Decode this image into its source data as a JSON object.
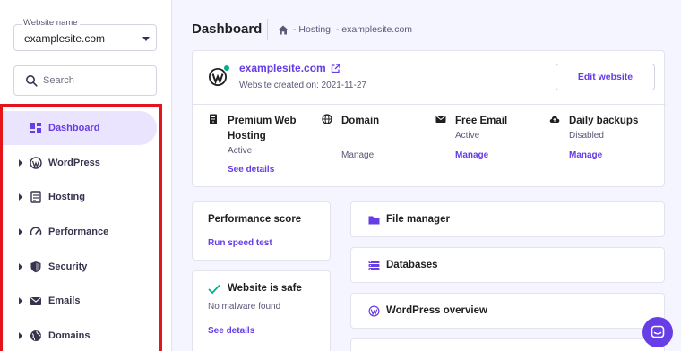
{
  "sidebar": {
    "website_select": {
      "label": "Website name",
      "value": "examplesite.com"
    },
    "search": {
      "placeholder": "Search"
    },
    "items": [
      {
        "label": "Dashboard",
        "icon": "dashboard-icon",
        "active": true
      },
      {
        "label": "WordPress",
        "icon": "wordpress-icon",
        "active": false
      },
      {
        "label": "Hosting",
        "icon": "server-icon",
        "active": false
      },
      {
        "label": "Performance",
        "icon": "speedometer-icon",
        "active": false
      },
      {
        "label": "Security",
        "icon": "shield-icon",
        "active": false
      },
      {
        "label": "Emails",
        "icon": "envelope-icon",
        "active": false
      },
      {
        "label": "Domains",
        "icon": "globe-icon",
        "active": false
      }
    ]
  },
  "header": {
    "title": "Dashboard",
    "breadcrumb": "- Hosting  - examplesite.com"
  },
  "site_card": {
    "name": "examplesite.com",
    "created": "Website created on: 2021-11-27",
    "edit_label": "Edit website",
    "services": [
      {
        "title_line1": "Premium Web",
        "title_line2": "Hosting",
        "status": "Active",
        "link": "See details",
        "icon": "server-icon"
      },
      {
        "title_line1": "Domain",
        "status": "",
        "link": "Manage",
        "icon": "globe-icon"
      },
      {
        "title_line1": "Free Email",
        "status": "Active",
        "link": "Manage",
        "icon": "envelope-icon"
      },
      {
        "title_line1": "Daily backups",
        "status": "Disabled",
        "link": "Manage",
        "icon": "cloud-upload-icon"
      }
    ]
  },
  "performance": {
    "title": "Performance score",
    "link": "Run speed test"
  },
  "safety": {
    "title": "Website is safe",
    "text": "No malware found",
    "link": "See details"
  },
  "tools": [
    {
      "label": "File manager",
      "icon": "folder-icon"
    },
    {
      "label": "Databases",
      "icon": "database-icon"
    },
    {
      "label": "WordPress overview",
      "icon": "wordpress-icon"
    }
  ],
  "colors": {
    "accent": "#673de6",
    "active_bg": "#ebe4ff",
    "success": "#00b090",
    "highlight": "#e3151a"
  }
}
